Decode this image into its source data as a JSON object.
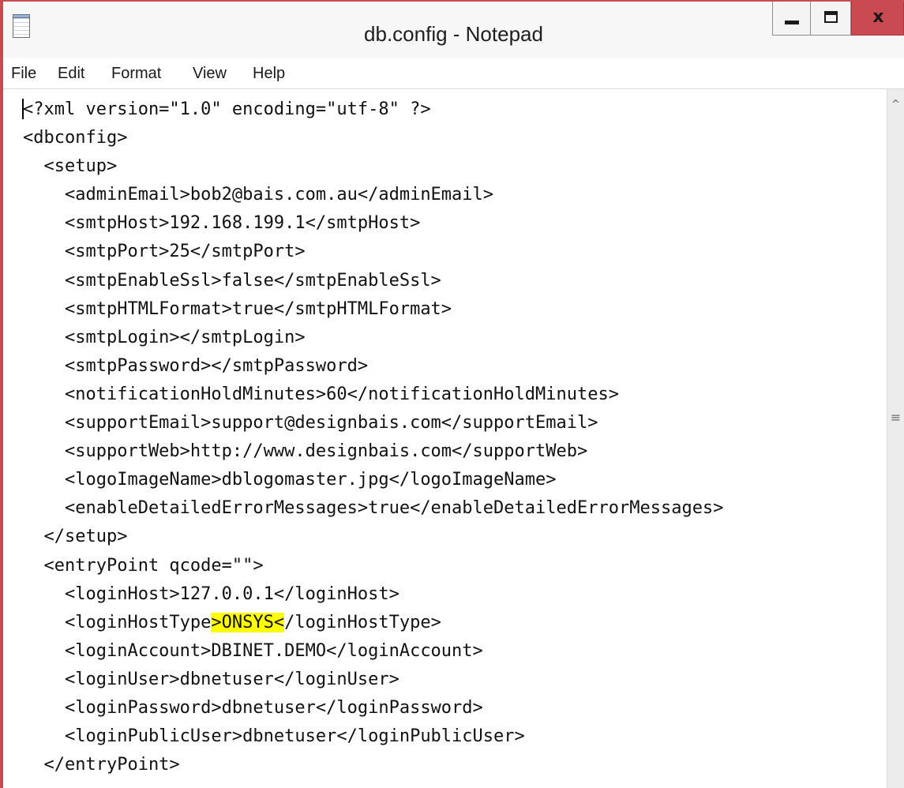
{
  "window": {
    "title": "db.config - Notepad",
    "app_icon": "notepad-icon",
    "controls": {
      "minimize_icon": "minimize-icon",
      "maximize_icon": "maximize-icon",
      "close_label": "x"
    },
    "accent_color": "#c94a50"
  },
  "menubar": {
    "items": [
      {
        "label": "File"
      },
      {
        "label": "Edit"
      },
      {
        "label": "Format"
      },
      {
        "label": "View"
      },
      {
        "label": "Help"
      }
    ]
  },
  "editor": {
    "lines": [
      {
        "pre": "<?xml version=\"1.0\" encoding=\"utf-8\" ?>",
        "hl": "",
        "post": ""
      },
      {
        "pre": "<dbconfig>",
        "hl": "",
        "post": ""
      },
      {
        "pre": "  <setup>",
        "hl": "",
        "post": ""
      },
      {
        "pre": "    <adminEmail>bob2@bais.com.au</adminEmail>",
        "hl": "",
        "post": ""
      },
      {
        "pre": "    <smtpHost>192.168.199.1</smtpHost>",
        "hl": "",
        "post": ""
      },
      {
        "pre": "    <smtpPort>25</smtpPort>",
        "hl": "",
        "post": ""
      },
      {
        "pre": "    <smtpEnableSsl>false</smtpEnableSsl>",
        "hl": "",
        "post": ""
      },
      {
        "pre": "    <smtpHTMLFormat>true</smtpHTMLFormat>",
        "hl": "",
        "post": ""
      },
      {
        "pre": "    <smtpLogin></smtpLogin>",
        "hl": "",
        "post": ""
      },
      {
        "pre": "    <smtpPassword></smtpPassword>",
        "hl": "",
        "post": ""
      },
      {
        "pre": "    <notificationHoldMinutes>60</notificationHoldMinutes>",
        "hl": "",
        "post": ""
      },
      {
        "pre": "    <supportEmail>support@designbais.com</supportEmail>",
        "hl": "",
        "post": ""
      },
      {
        "pre": "    <supportWeb>http://www.designbais.com</supportWeb>",
        "hl": "",
        "post": ""
      },
      {
        "pre": "    <logoImageName>dblogomaster.jpg</logoImageName>",
        "hl": "",
        "post": ""
      },
      {
        "pre": "    <enableDetailedErrorMessages>true</enableDetailedErrorMessages>",
        "hl": "",
        "post": ""
      },
      {
        "pre": "  </setup>",
        "hl": "",
        "post": ""
      },
      {
        "pre": "  <entryPoint qcode=\"\">",
        "hl": "",
        "post": ""
      },
      {
        "pre": "    <loginHost>127.0.0.1</loginHost>",
        "hl": "",
        "post": ""
      },
      {
        "pre": "    <loginHostType",
        "hl": ">ONSYS<",
        "post": "/loginHostType>"
      },
      {
        "pre": "    <loginAccount>DBINET.DEMO</loginAccount>",
        "hl": "",
        "post": ""
      },
      {
        "pre": "    <loginUser>dbnetuser</loginUser>",
        "hl": "",
        "post": ""
      },
      {
        "pre": "    <loginPassword>dbnetuser</loginPassword>",
        "hl": "",
        "post": ""
      },
      {
        "pre": "    <loginPublicUser>dbnetuser</loginPublicUser>",
        "hl": "",
        "post": ""
      },
      {
        "pre": "  </entryPoint>",
        "hl": "",
        "post": ""
      }
    ],
    "highlight_color": "#ffff00"
  },
  "scrollbar": {
    "up_icon": "scroll-up-arrow-icon",
    "up_glyph": "^",
    "thumb_icon": "scroll-grip-icon",
    "thumb_glyph": "≡"
  }
}
